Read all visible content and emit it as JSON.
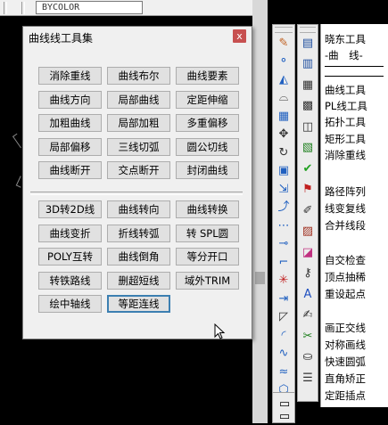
{
  "top_bar": {
    "color_combo": "BYCOLOR"
  },
  "dialog": {
    "title": "曲线线工具集",
    "close": "x",
    "group1": [
      [
        "消除重线",
        "曲线布尔",
        "曲线要素"
      ],
      [
        "曲线方向",
        "局部曲线",
        "定距伸缩"
      ],
      [
        "加粗曲线",
        "局部加粗",
        "多重偏移"
      ],
      [
        "局部偏移",
        "三线切弧",
        "圆公切线"
      ],
      [
        "曲线断开",
        "交点断开",
        "封闭曲线"
      ]
    ],
    "group2": [
      [
        "3D转2D线",
        "曲线转向",
        "曲线转换"
      ],
      [
        "曲线变折",
        "折线转弧",
        "转 SPL圆"
      ],
      [
        "POLY互转",
        "曲线倒角",
        "等分开口"
      ],
      [
        "转铁路线",
        "删超短线",
        "域外TRIM"
      ],
      [
        "绘中轴线",
        "等距连线"
      ]
    ]
  },
  "side_menu": {
    "header1": "晓东工具",
    "header2": "-曲　线-",
    "items_a": [
      "曲线工具",
      "PL线工具",
      "拓扑工具",
      "矩形工具",
      "消除重线"
    ],
    "items_b": [
      "路径阵列",
      "线变复线",
      "合并线段"
    ],
    "items_c": [
      "自交检查",
      "顶点抽稀",
      "重设起点"
    ],
    "items_d": [
      "画正交线",
      "对称画线",
      "快速圆弧",
      "直角矫正",
      "定距插点"
    ]
  },
  "toolbar_left_icons": [
    "pencil-icon",
    "circles-icon",
    "mirror-icon",
    "arc-icon",
    "grid-icon",
    "move-icon",
    "rotate-icon",
    "scale-icon",
    "stretch-icon",
    "break-icon",
    "dashline-icon",
    "chain-icon",
    "fillet-icon",
    "explode-icon",
    "join-icon",
    "chamfer-icon",
    "corner-icon",
    "curve-icon",
    "wave-icon",
    "cube-icon"
  ],
  "toolbar_right_icons": [
    "doc-icon",
    "doc2-icon",
    "table-icon",
    "film-icon",
    "layout-icon",
    "image-icon",
    "check-icon",
    "flag-icon",
    "pen-icon",
    "hatch-icon",
    "color-icon",
    "key-icon",
    "text-icon",
    "edit-icon",
    "scissors-icon",
    "stamp-icon",
    "stack-icon"
  ]
}
